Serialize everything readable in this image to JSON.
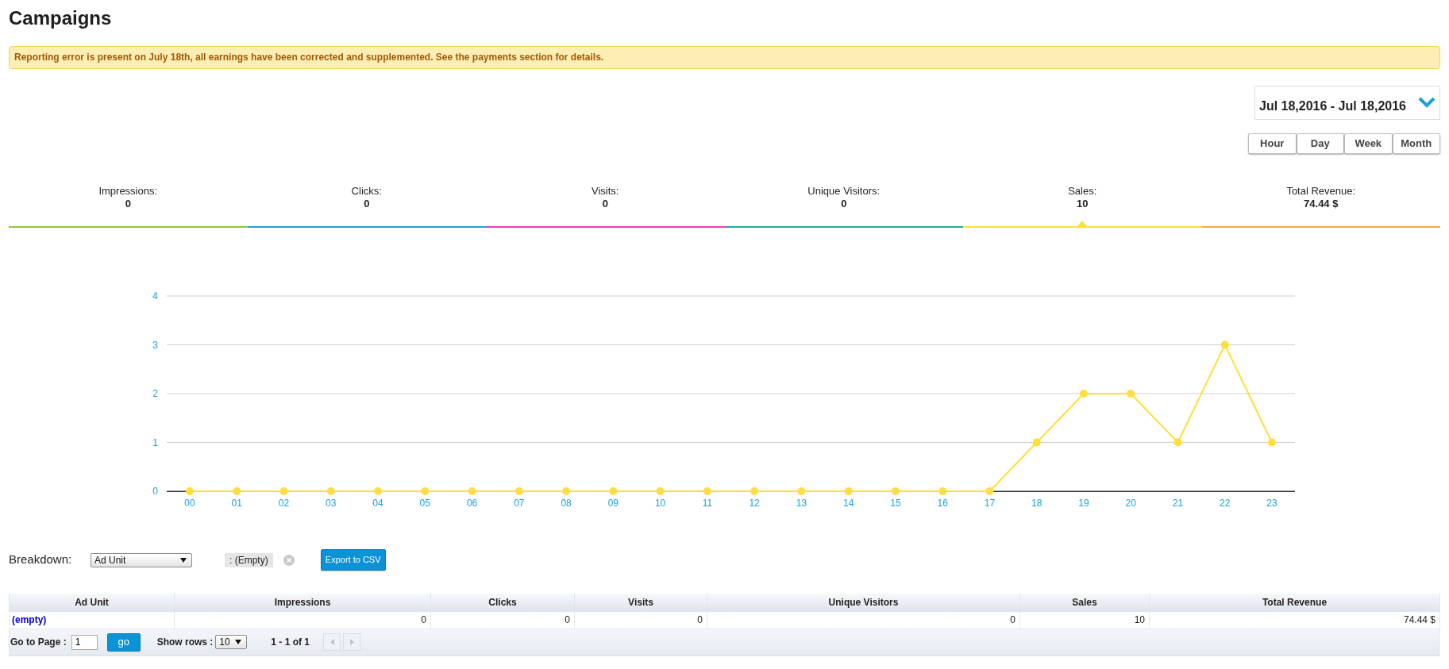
{
  "page": {
    "title": "Campaigns"
  },
  "alert": {
    "text": "Reporting error is present on July 18th, all earnings have been corrected and supplemented. See the payments section for details."
  },
  "date_range": {
    "value": "Jul 18,2016 - Jul 18,2016"
  },
  "granularity": [
    {
      "label": "Hour"
    },
    {
      "label": "Day"
    },
    {
      "label": "Week"
    },
    {
      "label": "Month"
    }
  ],
  "metrics": [
    {
      "label": "Impressions:",
      "value": "0",
      "color": "#8cc63f",
      "selected": false
    },
    {
      "label": "Clicks:",
      "value": "0",
      "color": "#279fdb",
      "selected": false
    },
    {
      "label": "Visits:",
      "value": "0",
      "color": "#e43fb7",
      "selected": false
    },
    {
      "label": "Unique Visitors:",
      "value": "0",
      "color": "#27aba0",
      "selected": false
    },
    {
      "label": "Sales:",
      "value": "10",
      "color": "#ffdf3a",
      "selected": true
    },
    {
      "label": "Total Revenue:",
      "value": "74.44 $",
      "color": "#f7a848",
      "selected": false
    }
  ],
  "chart": {
    "chart_data": {
      "type": "line",
      "categories": [
        "00",
        "01",
        "02",
        "03",
        "04",
        "05",
        "06",
        "07",
        "08",
        "09",
        "10",
        "11",
        "12",
        "13",
        "14",
        "15",
        "16",
        "17",
        "18",
        "19",
        "20",
        "21",
        "22",
        "23"
      ],
      "series": [
        {
          "color": "#ffdf3a",
          "marker": true,
          "values": [
            0,
            0,
            0,
            0,
            0,
            0,
            0,
            0,
            0,
            0,
            0,
            0,
            0,
            0,
            0,
            0,
            0,
            0,
            1,
            2,
            2,
            1,
            3,
            1
          ]
        }
      ],
      "ylim": [
        0,
        4
      ],
      "yticks": [
        0,
        1,
        2,
        3,
        4
      ],
      "grid": true
    }
  },
  "breakdown": {
    "label": "Breakdown:",
    "select": "Ad Unit",
    "filter_tag": ": (Empty)",
    "export_button": "Export to CSV"
  },
  "table": {
    "columns": [
      "Ad Unit",
      "Impressions",
      "Clicks",
      "Visits",
      "Unique Visitors",
      "Sales",
      "Total Revenue"
    ],
    "rows": [
      [
        "(empty)",
        "0",
        "0",
        "0",
        "0",
        "10",
        "74.44 $"
      ]
    ]
  },
  "pagination": {
    "page_label": "Go to Page :",
    "page_value": "1",
    "go_button": "go",
    "rows_label": "Show rows :",
    "rows_value": "10",
    "range": "1 - 1 of 1",
    "previous_disabled": true,
    "next_disabled": true
  }
}
